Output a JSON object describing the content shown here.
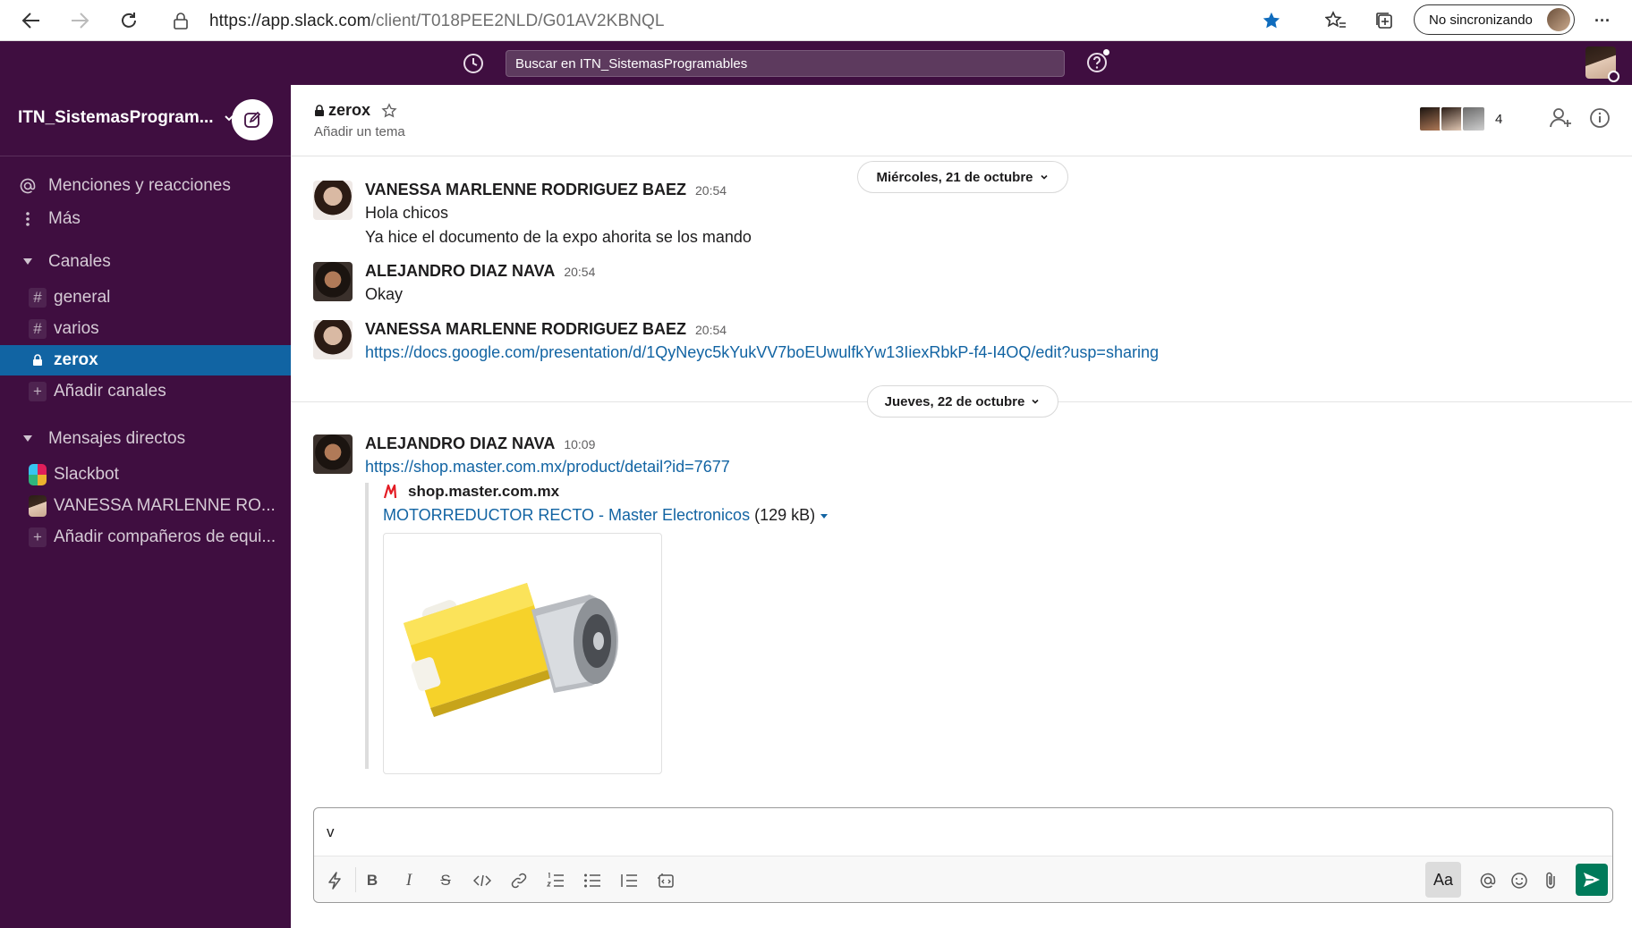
{
  "browser": {
    "url_host": "https://app.slack.com",
    "url_path": "/client/T018PEE2NLD/G01AV2KBNQL",
    "sync_label": "No sincronizando",
    "more_label": "···"
  },
  "topbar": {
    "search_text": "Buscar en ITN_SistemasProgramables"
  },
  "sidebar": {
    "workspace_name": "ITN_SistemasProgram...",
    "mentions_label": "Menciones y reacciones",
    "more_label": "Más",
    "channels_heading": "Canales",
    "channels": [
      {
        "name": "general",
        "active": false
      },
      {
        "name": "varios",
        "active": false
      },
      {
        "name": "zerox",
        "active": true
      }
    ],
    "add_channels_label": "Añadir canales",
    "dm_heading": "Mensajes directos",
    "dms": [
      {
        "name": "Slackbot"
      },
      {
        "name": "VANESSA MARLENNE RO..."
      }
    ],
    "add_teammates_label": "Añadir compañeros de equi..."
  },
  "channel": {
    "name": "zerox",
    "topic": "Añadir un tema",
    "member_count": "4"
  },
  "messages": {
    "date1": "Miércoles, 21 de octubre",
    "date2": "Jueves, 22 de octubre",
    "m1": {
      "author": "VANESSA MARLENNE RODRIGUEZ BAEZ",
      "time": "20:54",
      "line1": "Hola chicos",
      "line2": "Ya hice el documento de la expo ahorita se los mando"
    },
    "m2": {
      "author": "ALEJANDRO DIAZ NAVA",
      "time": "20:54",
      "line1": "Okay"
    },
    "m3": {
      "author": "VANESSA MARLENNE RODRIGUEZ BAEZ",
      "time": "20:54",
      "link": "https://docs.google.com/presentation/d/1QyNeyc5kYukVV7boEUwulfkYw13IiexRbkP-f4-I4OQ/edit?usp=sharing"
    },
    "m4": {
      "author": "ALEJANDRO DIAZ NAVA",
      "time": "10:09",
      "link": "https://shop.master.com.mx/product/detail?id=7677",
      "unfurl_site": "shop.master.com.mx",
      "unfurl_title": "MOTORREDUCTOR RECTO - Master Electronicos",
      "unfurl_size": "(129 kB)"
    }
  },
  "composer": {
    "text": "v",
    "format_label": "Aa"
  },
  "colors": {
    "aubergine": "#3f0e40",
    "active_blue": "#1164a3",
    "link_blue": "#1264a3",
    "send_green": "#007a5a"
  }
}
